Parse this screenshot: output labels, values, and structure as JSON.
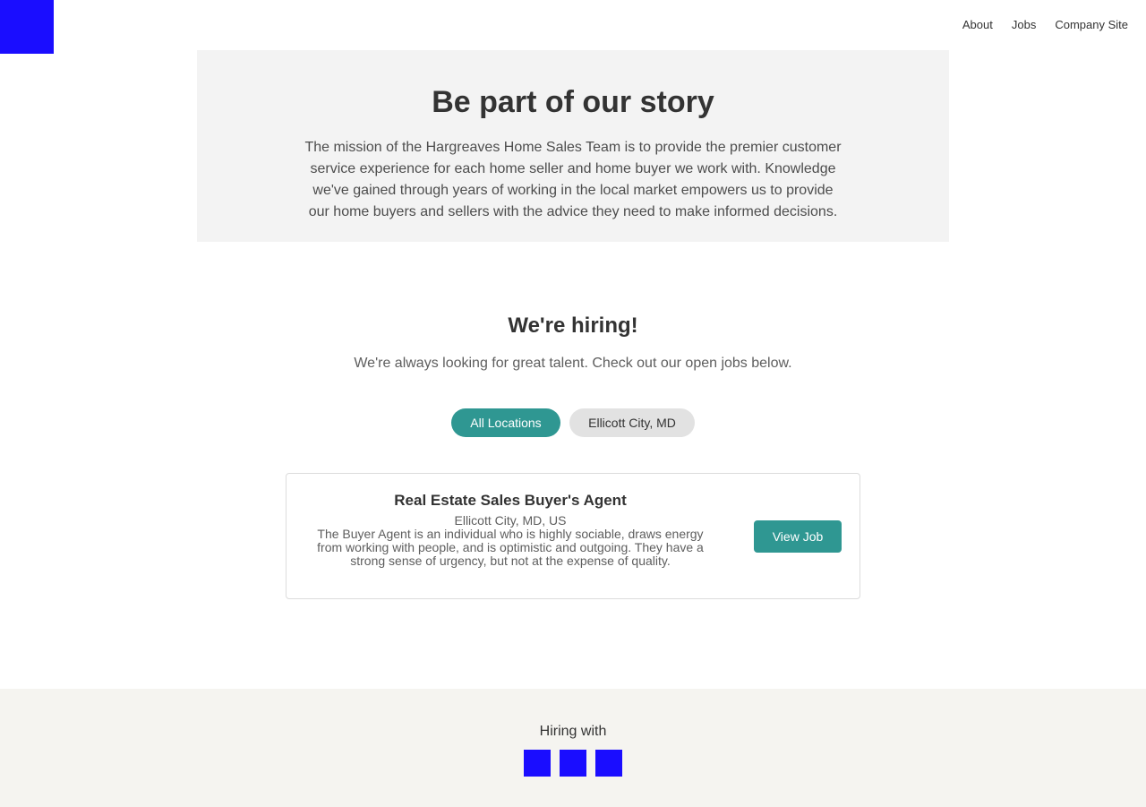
{
  "header": {
    "logo_icon": "company-logo-placeholder",
    "logo_color": "#1a0dff",
    "nav": [
      {
        "label": "About"
      },
      {
        "label": "Jobs"
      },
      {
        "label": "Company Site"
      }
    ]
  },
  "hero": {
    "title": "Be part of our story",
    "body": "The mission of the Hargreaves Home Sales Team is to provide the premier customer service experience for each home seller and home buyer we work with. Knowledge we've gained through years of working in the local market empowers us to provide our home buyers and sellers with the advice they need to make informed decisions."
  },
  "hiring": {
    "title": "We're hiring!",
    "subtitle": "We're always looking for great talent. Check out our open jobs below.",
    "filters": [
      {
        "label": "All Locations",
        "selected": true
      },
      {
        "label": "Ellicott City, MD",
        "selected": false
      }
    ]
  },
  "jobs": [
    {
      "title": "Real Estate Sales Buyer's Agent",
      "location": "Ellicott City, MD, US",
      "description": "The Buyer Agent is an individual who is highly sociable, draws energy from working with people, and is optimistic and outgoing. They have a strong sense of urgency, but not at the expense of quality.",
      "action_label": "View Job"
    }
  ],
  "footer": {
    "label": "Hiring with",
    "logos": [
      "partner-logo-icon",
      "partner-logo-icon",
      "partner-logo-icon"
    ]
  },
  "colors": {
    "accent": "#2f9792",
    "placeholder_blue": "#1a0dff",
    "hero_bg": "#f3f3f3",
    "footer_bg": "#f5f4f0"
  }
}
